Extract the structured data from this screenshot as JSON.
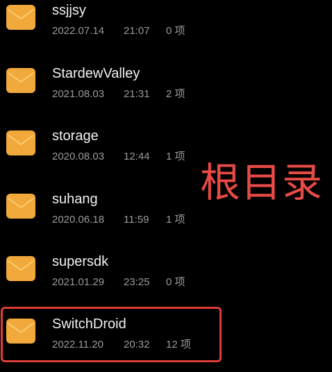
{
  "folders": [
    {
      "name": "ssjjsy",
      "date": "2022.07.14",
      "time": "21:07",
      "count": "0 项"
    },
    {
      "name": "StardewValley",
      "date": "2021.08.03",
      "time": "21:31",
      "count": "2 项"
    },
    {
      "name": "storage",
      "date": "2020.08.03",
      "time": "12:44",
      "count": "1 项"
    },
    {
      "name": "suhang",
      "date": "2020.06.18",
      "time": "11:59",
      "count": "1 项"
    },
    {
      "name": "supersdk",
      "date": "2021.01.29",
      "time": "23:25",
      "count": "0 项"
    },
    {
      "name": "SwitchDroid",
      "date": "2022.11.20",
      "time": "20:32",
      "count": "12 项"
    }
  ],
  "annotation": {
    "label": "根目录",
    "color": "#e84a45",
    "highlighted_folder": "SwitchDroid"
  },
  "colors": {
    "background": "#000000",
    "folder_icon": "#f2a93b",
    "folder_icon_flap": "#f7c25f",
    "name_text": "#f2f2f2",
    "meta_text": "#9a9a9a",
    "highlight_border": "#e03c38"
  },
  "icons": {
    "folder": "folder-icon"
  }
}
